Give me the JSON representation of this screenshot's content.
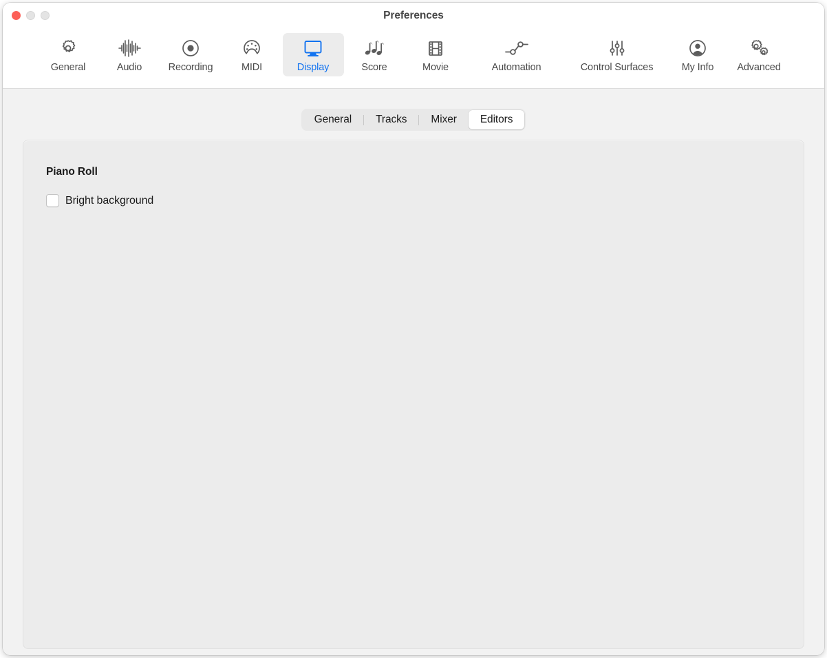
{
  "window": {
    "title": "Preferences",
    "traffic_lights": [
      {
        "name": "close",
        "color": "#fc6058"
      },
      {
        "name": "minimize",
        "color": "#e4e4e4"
      },
      {
        "name": "zoom",
        "color": "#e4e4e4"
      }
    ]
  },
  "toolbar": {
    "selected": "Display",
    "accent_color": "#1273f0",
    "items": [
      {
        "label": "General",
        "icon": "gear-icon"
      },
      {
        "label": "Audio",
        "icon": "waveform-icon"
      },
      {
        "label": "Recording",
        "icon": "record-dot-icon"
      },
      {
        "label": "MIDI",
        "icon": "midi-connector-icon"
      },
      {
        "label": "Display",
        "icon": "monitor-icon"
      },
      {
        "label": "Score",
        "icon": "music-notes-icon"
      },
      {
        "label": "Movie",
        "icon": "film-strip-icon"
      },
      {
        "label": "Automation",
        "icon": "automation-nodes-icon"
      },
      {
        "label": "Control Surfaces",
        "icon": "sliders-icon"
      },
      {
        "label": "My Info",
        "icon": "person-circle-icon"
      },
      {
        "label": "Advanced",
        "icon": "double-gear-icon"
      }
    ]
  },
  "segmented": {
    "selected": "Editors",
    "tabs": [
      {
        "label": "General"
      },
      {
        "label": "Tracks"
      },
      {
        "label": "Mixer"
      },
      {
        "label": "Editors"
      }
    ]
  },
  "panel": {
    "group_title": "Piano Roll",
    "checkbox": {
      "label": "Bright background",
      "checked": false
    }
  }
}
